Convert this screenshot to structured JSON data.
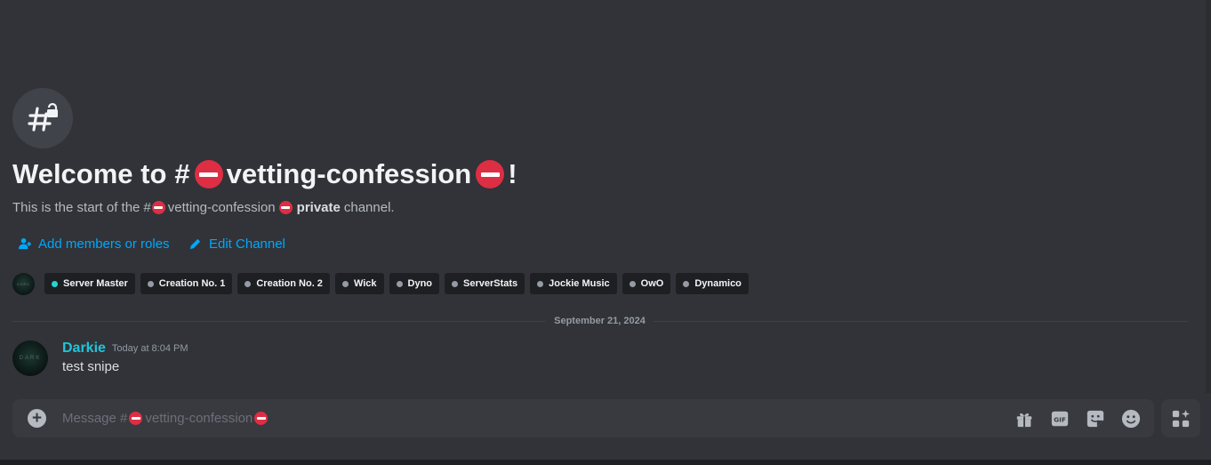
{
  "channel": {
    "name": "vetting-confession",
    "hash": "#",
    "icon": "hashtag-lock-icon"
  },
  "welcome": {
    "prefix": "Welcome to",
    "suffix": "!"
  },
  "subtitle": {
    "prefix": "This is the start of the",
    "private_label": "private",
    "suffix": "channel."
  },
  "actions": {
    "add_members_label": "Add members or roles",
    "edit_channel_label": "Edit Channel"
  },
  "members": [
    {
      "name": "Server Master",
      "online": true
    },
    {
      "name": "Creation No. 1",
      "online": false
    },
    {
      "name": "Creation No. 2",
      "online": false
    },
    {
      "name": "Wick",
      "online": false
    },
    {
      "name": "Dyno",
      "online": false
    },
    {
      "name": "ServerStats",
      "online": false
    },
    {
      "name": "Jockie Music",
      "online": false
    },
    {
      "name": "OwO",
      "online": false
    },
    {
      "name": "Dynamico",
      "online": false
    }
  ],
  "divider_date": "September 21, 2024",
  "message": {
    "author": "Darkie",
    "timestamp": "Today at 8:04 PM",
    "text": "test snipe",
    "author_color": "#1fc5d9",
    "avatar_text": "DARK"
  },
  "composer": {
    "placeholder_prefix": "Message #",
    "tools": [
      "gift-icon",
      "gif-icon",
      "sticker-icon",
      "emoji-icon"
    ]
  },
  "colors": {
    "background": "#313338",
    "link": "#00a8fc",
    "no_entry": "#dd2e44",
    "online": "#23d5d2"
  }
}
